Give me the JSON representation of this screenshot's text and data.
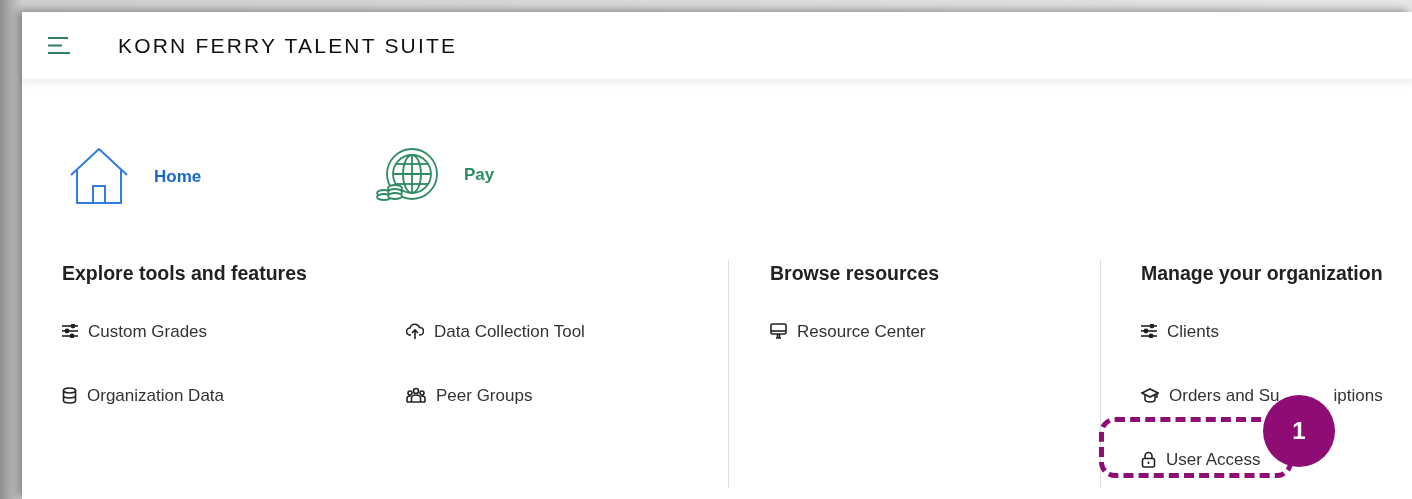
{
  "header": {
    "title": "KORN FERRY TALENT SUITE"
  },
  "apps": [
    {
      "label": "Home",
      "kind": "home"
    },
    {
      "label": "Pay",
      "kind": "pay"
    }
  ],
  "sections": [
    {
      "title": "Explore tools and features",
      "items": [
        {
          "label": "Custom Grades",
          "kind": "sliders"
        },
        {
          "label": "Data Collection Tool",
          "kind": "cloud"
        },
        {
          "label": "Organization Data",
          "kind": "database"
        },
        {
          "label": "Peer Groups",
          "kind": "people"
        }
      ]
    },
    {
      "title": "Browse resources",
      "items": [
        {
          "label": "Resource Center",
          "kind": "monitor"
        }
      ]
    },
    {
      "title": "Manage your organization",
      "items": [
        {
          "label": "Clients",
          "kind": "sliders"
        },
        {
          "label": "Orders and Su",
          "label_tail": "iptions",
          "kind": "cap"
        },
        {
          "label": "User Access",
          "kind": "lock",
          "callout": "1"
        }
      ]
    }
  ]
}
